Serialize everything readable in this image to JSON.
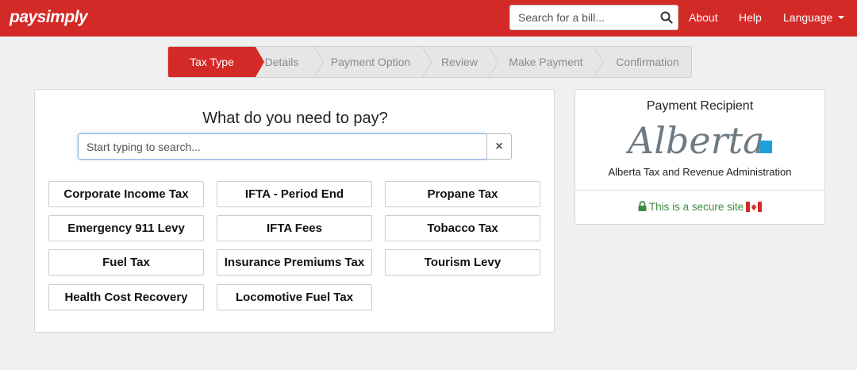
{
  "navbar": {
    "logo": "paysimply",
    "search_placeholder": "Search for a bill...",
    "about": "About",
    "help": "Help",
    "language": "Language"
  },
  "steps": [
    {
      "label": "Tax Type",
      "active": true
    },
    {
      "label": "Details",
      "active": false
    },
    {
      "label": "Payment Option",
      "active": false
    },
    {
      "label": "Review",
      "active": false
    },
    {
      "label": "Make Payment",
      "active": false
    },
    {
      "label": "Confirmation",
      "active": false
    }
  ],
  "main": {
    "title": "What do you need to pay?",
    "search_placeholder": "Start typing to search...",
    "clear_symbol": "×",
    "tax_types": [
      "Corporate Income Tax",
      "IFTA - Period End",
      "Propane Tax",
      "Emergency 911 Levy",
      "IFTA Fees",
      "Tobacco Tax",
      "Fuel Tax",
      "Insurance Premiums Tax",
      "Tourism Levy",
      "Health Cost Recovery",
      "Locomotive Fuel Tax"
    ]
  },
  "side": {
    "title": "Payment Recipient",
    "logo_text": "Alberta",
    "recipient": "Alberta Tax and Revenue Administration",
    "secure_text": "This is a secure site"
  },
  "colors": {
    "brand_red": "#d42a27",
    "secure_green": "#3d8b3d",
    "alberta_blue": "#1ea0d8"
  }
}
